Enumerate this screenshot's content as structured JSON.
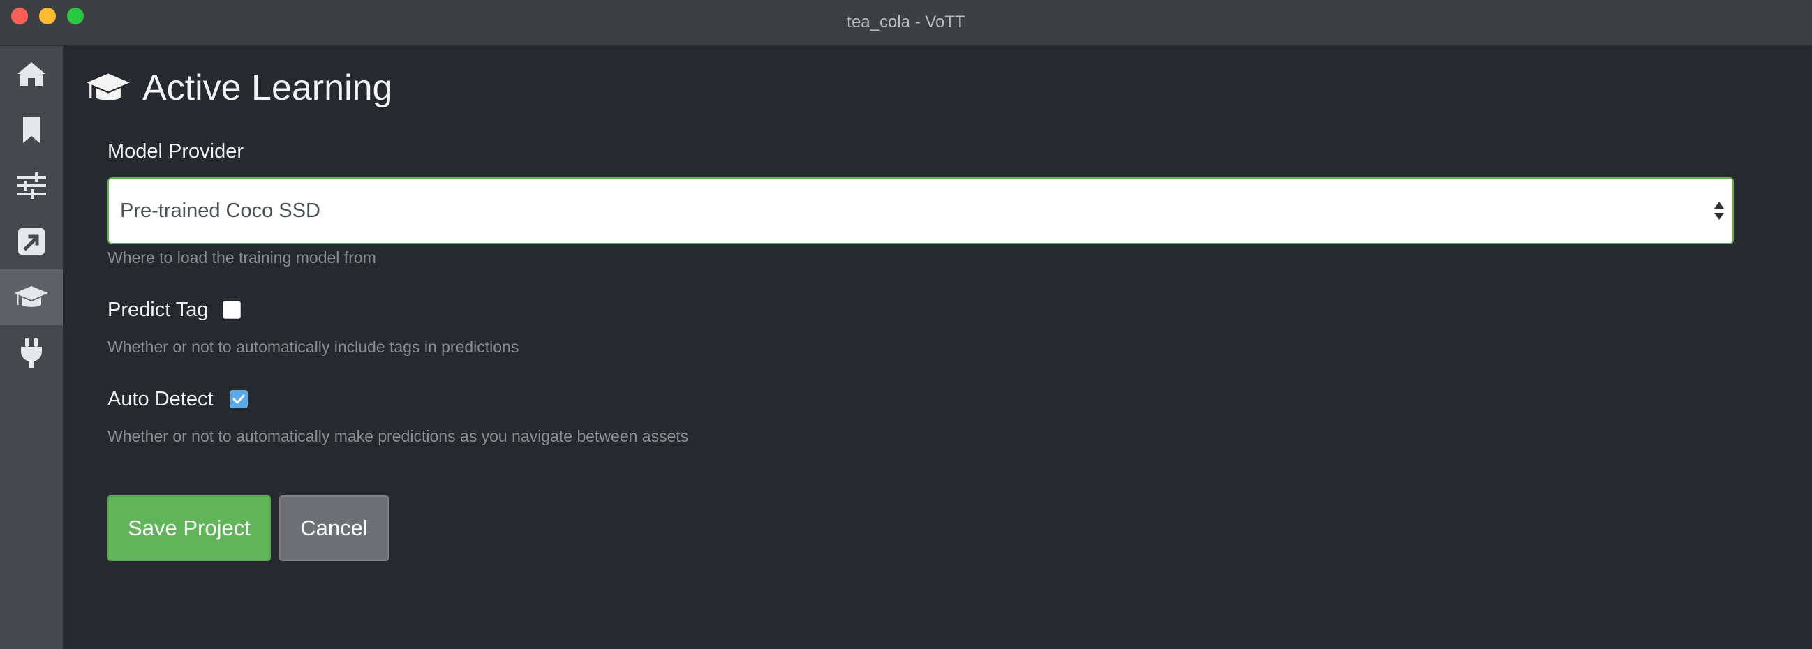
{
  "window": {
    "title": "tea_cola - VoTT"
  },
  "sidebar": {
    "items": [
      {
        "icon": "home-icon",
        "active": false
      },
      {
        "icon": "bookmark-icon",
        "active": false
      },
      {
        "icon": "sliders-icon",
        "active": false
      },
      {
        "icon": "export-icon",
        "active": false
      },
      {
        "icon": "graduation-cap-icon",
        "active": true
      },
      {
        "icon": "plug-icon",
        "active": false
      }
    ]
  },
  "page": {
    "title": "Active Learning",
    "icon": "graduation-cap-icon"
  },
  "form": {
    "model_provider": {
      "label": "Model Provider",
      "value": "Pre-trained Coco SSD",
      "help": "Where to load the training model from"
    },
    "predict_tag": {
      "label": "Predict Tag",
      "checked": false,
      "help": "Whether or not to automatically include tags in predictions"
    },
    "auto_detect": {
      "label": "Auto Detect",
      "checked": true,
      "help": "Whether or not to automatically make predictions as you navigate between assets"
    }
  },
  "buttons": {
    "save": "Save Project",
    "cancel": "Cancel"
  },
  "colors": {
    "accent_green": "#62b45b",
    "checkbox_blue": "#5ba9e6",
    "background": "#26292e"
  }
}
